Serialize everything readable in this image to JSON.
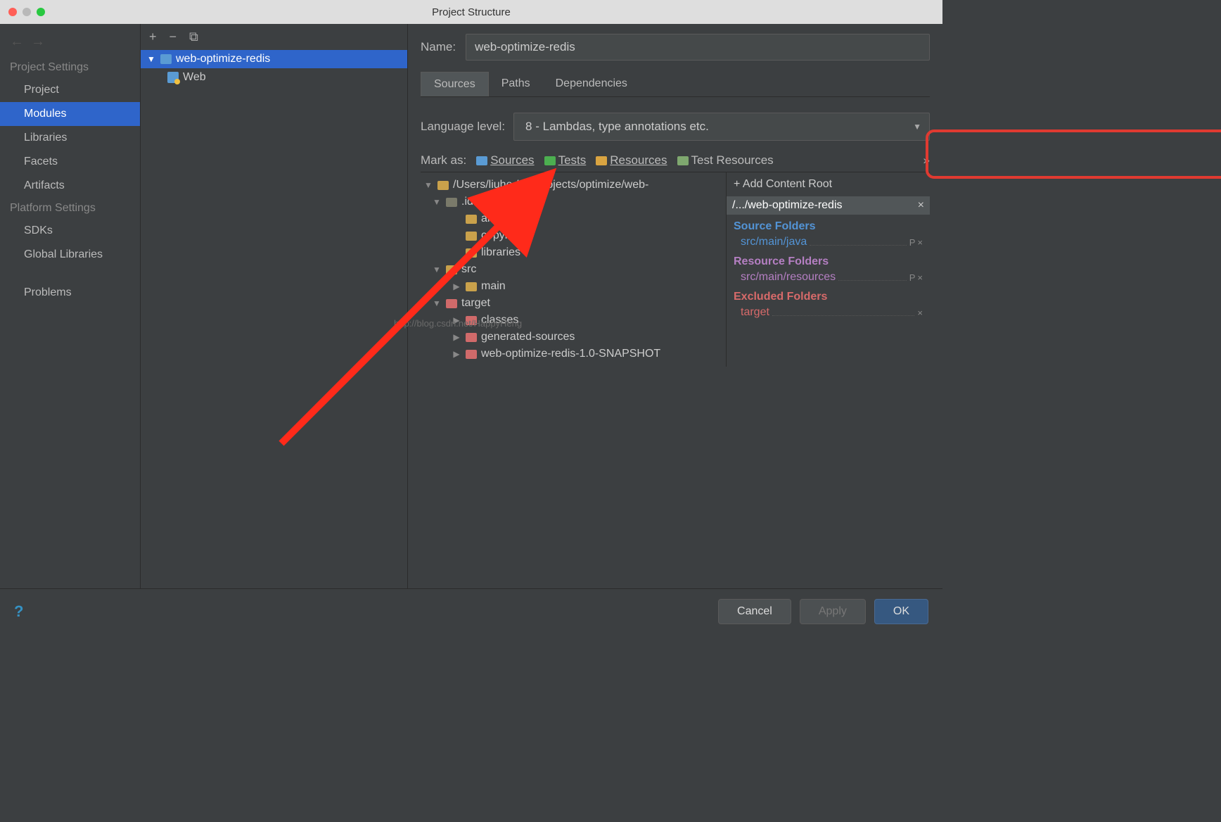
{
  "window_title": "Project Structure",
  "sidebar": {
    "nav_back": "←",
    "nav_fwd": "→",
    "section1": "Project Settings",
    "items1": [
      "Project",
      "Modules",
      "Libraries",
      "Facets",
      "Artifacts"
    ],
    "section2": "Platform Settings",
    "items2": [
      "SDKs",
      "Global Libraries"
    ],
    "problems": "Problems"
  },
  "modtree": {
    "add": "+",
    "remove": "−",
    "copy": "⧉",
    "root": "web-optimize-redis",
    "child": "Web"
  },
  "detail": {
    "name_label": "Name:",
    "name_value": "web-optimize-redis",
    "tabs": [
      "Sources",
      "Paths",
      "Dependencies"
    ],
    "lang_label": "Language level:",
    "lang_value": "8 - Lambdas, type annotations etc.",
    "mark_label": "Mark as:",
    "mark_items": [
      "Sources",
      "Tests",
      "Resources",
      "Test Resources"
    ],
    "mark_more": "»"
  },
  "filetree": {
    "root": "/Users/liuhe     /devprojects/optimize/web-",
    "idea": ".idea",
    "artifacts": "artifacts",
    "copyright": "copyright",
    "libraries": "libraries",
    "src": "src",
    "main": "main",
    "target": "target",
    "classes": "classes",
    "gensrc": "generated-sources",
    "snap": "web-optimize-redis-1.0-SNAPSHOT"
  },
  "cp": {
    "add": "+ Add Content Root",
    "hdr": "/.../web-optimize-redis",
    "src_h": "Source Folders",
    "src_i": "src/main/java",
    "res_h": "Resource Folders",
    "res_i": "src/main/resources",
    "exc_h": "Excluded Folders",
    "exc_i": "target",
    "p": "P",
    "x": "×"
  },
  "watermark": "http://blog.csdn.net/HappyHeng",
  "buttons": {
    "cancel": "Cancel",
    "apply": "Apply",
    "ok": "OK",
    "help": "?"
  }
}
